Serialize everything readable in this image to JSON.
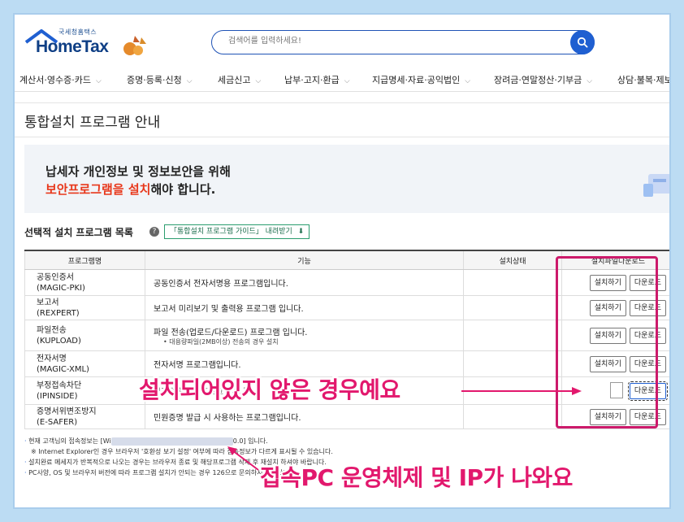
{
  "header": {
    "logo_sub": "국세청홈택스",
    "logo_name": "HomeTax",
    "search_placeholder": "검색어를 입력하세요!"
  },
  "nav": [
    {
      "label": "계산서·영수증·카드"
    },
    {
      "label": "증명·등록·신청"
    },
    {
      "label": "세금신고"
    },
    {
      "label": "납부·고지·환급"
    },
    {
      "label": "지급명세·자료·공익법인"
    },
    {
      "label": "장려금·연말정산·기부금"
    },
    {
      "label": "상담·불복·제보"
    }
  ],
  "page_title": "통합설치 프로그램 안내",
  "banner": {
    "line1": "납세자 개인정보 및 정보보안을 위해",
    "line2_highlight": "보안프로그램을 설치",
    "line2_rest": "해야 합니다."
  },
  "section": {
    "title": "선택적 설치 프로그램 목록",
    "help": "?",
    "guide_button": "「통합설치 프로그램 가이드」 내려받기"
  },
  "table": {
    "headers": [
      "프로그램명",
      "기능",
      "설치상태",
      "설치파일다운로드"
    ],
    "rows": [
      {
        "name": "공동인증서",
        "code": "(MAGIC-PKI)",
        "desc": "공동인증서 전자서명용 프로그램입니다.",
        "note": "",
        "status": "",
        "install": "설치하기",
        "download": "다운로드"
      },
      {
        "name": "보고서",
        "code": "(REXPERT)",
        "desc": "보고서 미리보기 및 출력용 프로그램 입니다.",
        "note": "",
        "status": "",
        "install": "설치하기",
        "download": "다운로드"
      },
      {
        "name": "파일전송",
        "code": "(KUPLOAD)",
        "desc": "파일 전송(업로드/다운로드) 프로그램 입니다.",
        "note": "• 대용량파일(2MB이상) 전송의 경우 설치",
        "status": "",
        "install": "설치하기",
        "download": "다운로드"
      },
      {
        "name": "전자서명",
        "code": "(MAGIC-XML)",
        "desc": "전자서명 프로그램입니다.",
        "note": "",
        "status": "",
        "install": "설치하기",
        "download": "다운로드"
      },
      {
        "name": "부정접속차단",
        "code": "(IPINSIDE)",
        "desc": "부정접속차단 프로그램입니다.",
        "note": "",
        "status": "",
        "install": "",
        "download": "다운로드"
      },
      {
        "name": "증명서위변조방지",
        "code": "(E-SAFER)",
        "desc": "민원증명 발급 시 사용하는 프로그램입니다.",
        "note": "",
        "status": "",
        "install": "설치하기",
        "download": "다운로드"
      }
    ]
  },
  "notes": {
    "n1_prefix": "현재 고객님의 접속정보는 [Wi",
    "n1_suffix": "0.0] 입니다.",
    "n1b": "※ Internet Explorer인 경우 브라우저 '호환성 보기 설정' 여부에 따라 접속정보가 다르게 표시될 수 있습니다.",
    "n2": "설치완료 메세지가 반복적으로 나오는 경우는 브라우저 종료 및 해당프로그램 삭제 후 재설치 하셔야 바랍니다.",
    "n3": "PC사양, OS 및 브라우저 버전에 따라 프로그램 설치가 안되는 경우 126으로 문의하시기 바랍니다."
  },
  "annotations": {
    "a1": "설치되어있지 않은 경우예요",
    "a2": "접속PC 운영체제 및 IP가 나와요"
  },
  "colors": {
    "brand": "#0f3f85",
    "accent": "#1f5fd1",
    "highlight": "#e8371b",
    "annotation": "#e2186d"
  }
}
